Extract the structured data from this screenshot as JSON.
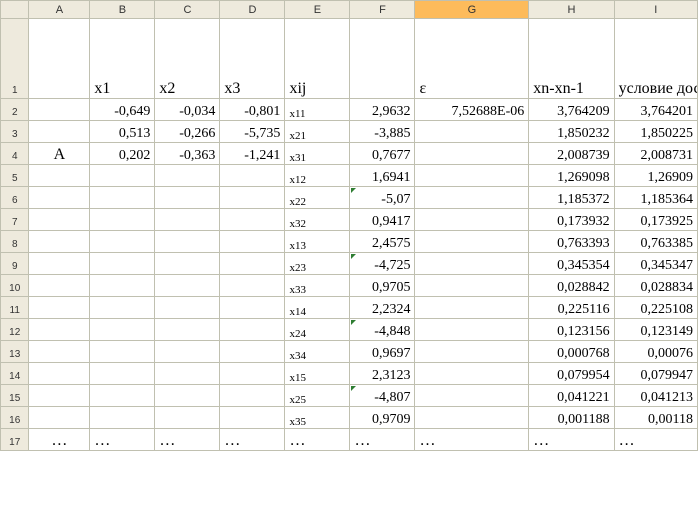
{
  "columns": [
    "A",
    "B",
    "C",
    "D",
    "E",
    "F",
    "G",
    "H",
    "I"
  ],
  "selected_col": "G",
  "header": {
    "B": "x1",
    "C": "x2",
    "D": "x3",
    "E": "xij",
    "G": "ε",
    "H": "xn-xn-1",
    "I": "условие достижения точности"
  },
  "rows": [
    {
      "n": "2",
      "A": "",
      "B": "-0,649",
      "C": "-0,034",
      "D": "-0,801",
      "E": "x11",
      "F": "2,9632",
      "G": "7,52688E-06",
      "H": "3,764209",
      "I": "3,764201"
    },
    {
      "n": "3",
      "A": "",
      "B": "0,513",
      "C": "-0,266",
      "D": "-5,735",
      "E": "x21",
      "F": "-3,885",
      "G": "",
      "H": "1,850232",
      "I": "1,850225"
    },
    {
      "n": "4",
      "A": "A",
      "B": "0,202",
      "C": "-0,363",
      "D": "-1,241",
      "E": "x31",
      "F": "0,7677",
      "G": "",
      "H": "2,008739",
      "I": "2,008731"
    },
    {
      "n": "5",
      "A": "",
      "B": "",
      "C": "",
      "D": "",
      "E": "x12",
      "F": "1,6941",
      "G": "",
      "H": "1,269098",
      "I": "1,26909"
    },
    {
      "n": "6",
      "A": "",
      "B": "",
      "C": "",
      "D": "",
      "E": "x22",
      "F": "-5,07",
      "G": "",
      "H": "1,185372",
      "I": "1,185364",
      "tri": true
    },
    {
      "n": "7",
      "A": "",
      "B": "",
      "C": "",
      "D": "",
      "E": "x32",
      "F": "0,9417",
      "G": "",
      "H": "0,173932",
      "I": "0,173925"
    },
    {
      "n": "8",
      "A": "",
      "B": "",
      "C": "",
      "D": "",
      "E": "x13",
      "F": "2,4575",
      "G": "",
      "H": "0,763393",
      "I": "0,763385"
    },
    {
      "n": "9",
      "A": "",
      "B": "",
      "C": "",
      "D": "",
      "E": "x23",
      "F": "-4,725",
      "G": "",
      "H": "0,345354",
      "I": "0,345347",
      "tri": true
    },
    {
      "n": "10",
      "A": "",
      "B": "",
      "C": "",
      "D": "",
      "E": "x33",
      "F": "0,9705",
      "G": "",
      "H": "0,028842",
      "I": "0,028834"
    },
    {
      "n": "11",
      "A": "",
      "B": "",
      "C": "",
      "D": "",
      "E": "x14",
      "F": "2,2324",
      "G": "",
      "H": "0,225116",
      "I": "0,225108"
    },
    {
      "n": "12",
      "A": "",
      "B": "",
      "C": "",
      "D": "",
      "E": "x24",
      "F": "-4,848",
      "G": "",
      "H": "0,123156",
      "I": "0,123149",
      "tri": true
    },
    {
      "n": "13",
      "A": "",
      "B": "",
      "C": "",
      "D": "",
      "E": "x34",
      "F": "0,9697",
      "G": "",
      "H": "0,000768",
      "I": "0,00076"
    },
    {
      "n": "14",
      "A": "",
      "B": "",
      "C": "",
      "D": "",
      "E": "x15",
      "F": "2,3123",
      "G": "",
      "H": "0,079954",
      "I": "0,079947"
    },
    {
      "n": "15",
      "A": "",
      "B": "",
      "C": "",
      "D": "",
      "E": "x25",
      "F": "-4,807",
      "G": "",
      "H": "0,041221",
      "I": "0,041213",
      "tri": true
    },
    {
      "n": "16",
      "A": "",
      "B": "",
      "C": "",
      "D": "",
      "E": "x35",
      "F": "0,9709",
      "G": "",
      "H": "0,001188",
      "I": "0,00118"
    },
    {
      "n": "17",
      "A": "…",
      "B": "…",
      "C": "…",
      "D": "…",
      "E": "…",
      "F": "…",
      "G": "…",
      "H": "…",
      "I": "…",
      "ellips": true
    }
  ]
}
